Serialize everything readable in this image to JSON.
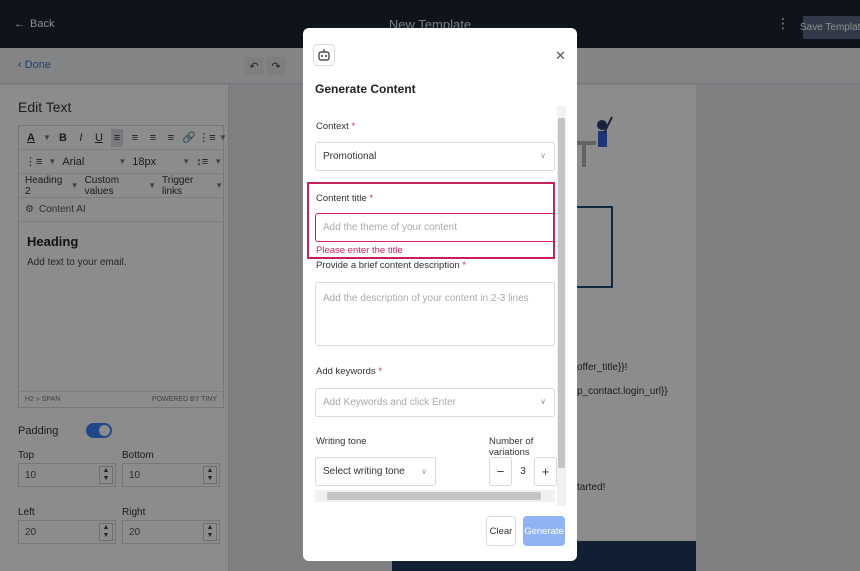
{
  "topbar": {
    "back_label": "Back",
    "title": "New Template",
    "save_label": "Save Template"
  },
  "subbar": {
    "done_label": "Done"
  },
  "left": {
    "title": "Edit Text",
    "toolbar": {
      "font": "Arial",
      "size": "18px",
      "heading": "Heading 2",
      "custom_values": "Custom values",
      "trigger_links": "Trigger links"
    },
    "content_ai": "Content AI",
    "editor_heading": "Heading",
    "editor_body": "Add text to your email.",
    "status_path": "H2 » SPAN",
    "status_brand": "POWERED BY TINY",
    "padding_label": "Padding",
    "top_label": "Top",
    "top_value": "10",
    "bottom_label": "Bottom",
    "bottom_value": "10",
    "left_label": "Left",
    "left_value": "20",
    "right_label": "Right",
    "right_value": "20"
  },
  "email": {
    "line1": "offer_title}}!",
    "line2": "p_contact.login_url}}",
    "line3": "tarted!"
  },
  "modal": {
    "title": "Generate Content",
    "context_label": "Context",
    "context_value": "Promotional",
    "content_title_label": "Content title",
    "content_title_placeholder": "Add the theme of your content",
    "content_title_error": "Please enter the title",
    "description_label": "Provide a brief content description",
    "description_placeholder": "Add the description of your content in 2-3 lines",
    "keywords_label": "Add keywords",
    "keywords_placeholder": "Add Keywords and click Enter",
    "tone_label": "Writing tone",
    "tone_placeholder": "Select writing tone",
    "variations_label": "Number of variations",
    "variations_value": "3",
    "clear_label": "Clear",
    "generate_label": "Generate"
  }
}
